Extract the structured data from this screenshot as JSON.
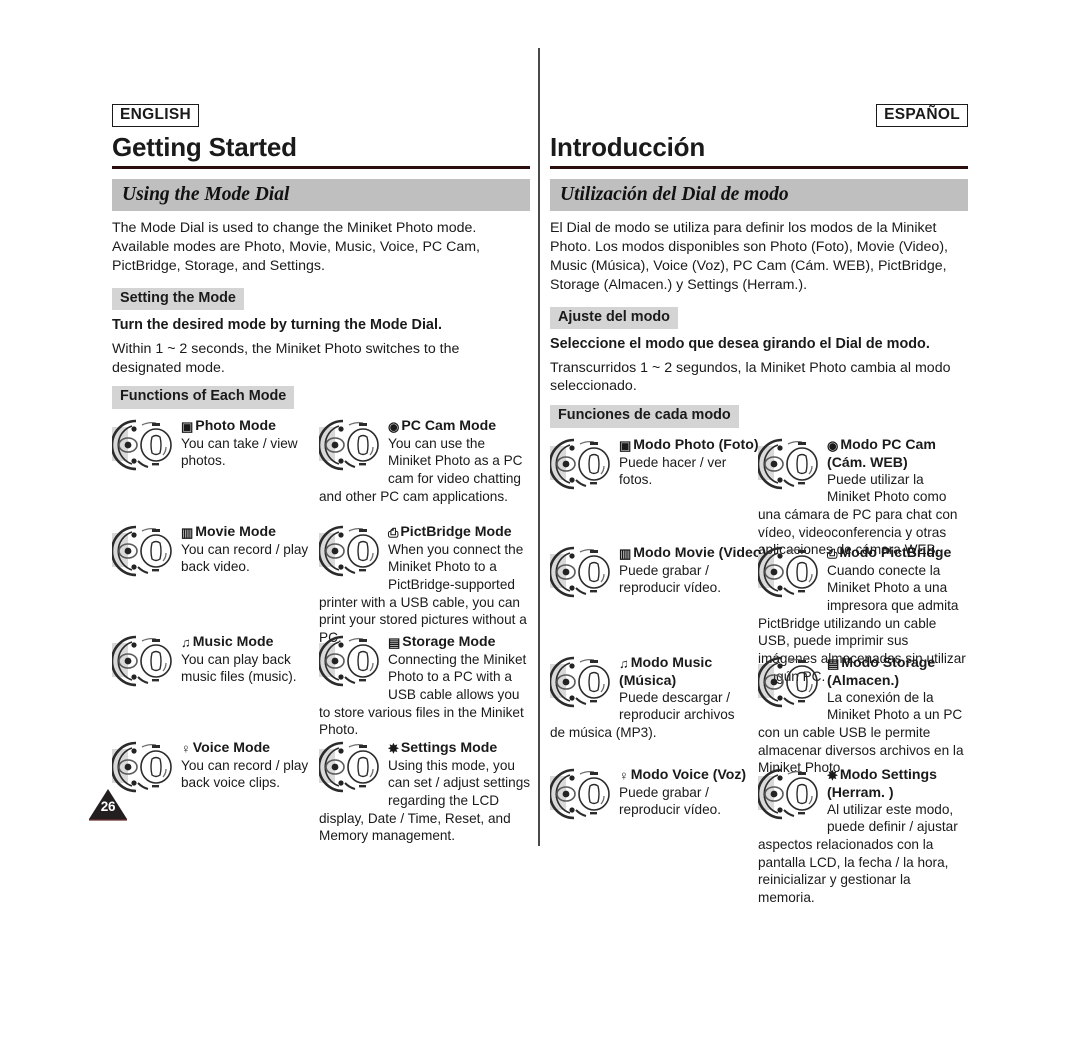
{
  "page": {
    "number": "26",
    "accent_rule_color": "#2b0d0d",
    "banner_bg": "#bfbfbf",
    "chip_bg": "#d4d4d4"
  },
  "english": {
    "lang_tag": "ENGLISH",
    "chapter_title": "Getting Started",
    "section_banner": "Using the Mode Dial",
    "intro": "The Mode Dial is used to change the Miniket Photo mode. Available modes are Photo, Movie, Music, Voice, PC Cam, PictBridge, Storage, and Settings.",
    "setting_chip": "Setting the Mode",
    "setting_bold": "Turn the desired mode by turning the Mode Dial.",
    "setting_text": "Within 1 ~ 2 seconds, the Miniket Photo switches to the designated mode.",
    "functions_chip": "Functions of Each Mode",
    "modes": [
      {
        "icon": "camera-icon",
        "heading": "Photo Mode",
        "heading2": "",
        "desc": "You can take / view photos."
      },
      {
        "icon": "webcam-icon",
        "heading": "PC Cam Mode",
        "heading2": "",
        "desc": "You can use the Miniket Photo as a PC cam for video chatting and other PC cam applications."
      },
      {
        "icon": "movie-camera-icon",
        "heading": "Movie Mode",
        "heading2": "",
        "desc": "You can record / play back video."
      },
      {
        "icon": "printer-icon",
        "heading": "PictBridge Mode",
        "heading2": "",
        "desc": "When you connect the Miniket Photo to a PictBridge-supported printer with a USB cable, you can print your stored pictures without a PC."
      },
      {
        "icon": "music-note-icon",
        "heading": "Music Mode",
        "heading2": "",
        "desc": "You can play back music files (music)."
      },
      {
        "icon": "storage-icon",
        "heading": "Storage Mode",
        "heading2": "",
        "desc": "Connecting the Miniket Photo to a PC with a USB cable allows you to store various files in the Miniket Photo."
      },
      {
        "icon": "microphone-icon",
        "heading": "Voice Mode",
        "heading2": "",
        "desc": "You can record / play back voice clips."
      },
      {
        "icon": "gear-icon",
        "heading": "Settings Mode",
        "heading2": "",
        "desc": "Using this mode, you can set / adjust settings regarding the LCD display, Date / Time, Reset, and Memory management."
      }
    ]
  },
  "spanish": {
    "lang_tag": "ESPAÑOL",
    "chapter_title": "Introducción",
    "section_banner": "Utilización del Dial de modo",
    "intro": "El Dial de modo se utiliza para definir los modos de la Miniket Photo. Los modos disponibles son Photo (Foto), Movie (Video), Music (Música), Voice (Voz), PC Cam (Cám. WEB), PictBridge, Storage (Almacen.) y Settings (Herram.).",
    "setting_chip": "Ajuste del modo",
    "setting_bold": "Seleccione el modo que desea girando el Dial de modo.",
    "setting_text": "Transcurridos 1 ~ 2 segundos, la Miniket Photo cambia al modo seleccionado.",
    "functions_chip": "Funciones de cada modo",
    "modes": [
      {
        "icon": "camera-icon",
        "heading": "Modo Photo (Foto)",
        "heading2": "",
        "desc": "Puede hacer / ver fotos."
      },
      {
        "icon": "webcam-icon",
        "heading": "Modo PC Cam",
        "heading2": "(Cám. WEB)",
        "desc": "Puede utilizar la Miniket Photo como una cámara de PC para chat con vídeo, videoconferencia y otras aplicaciones de cámara WEB."
      },
      {
        "icon": "movie-camera-icon",
        "heading": "Modo Movie (Video)",
        "heading2": "",
        "desc": "Puede grabar / reproducir vídeo."
      },
      {
        "icon": "printer-icon",
        "heading": "Modo PictBridge",
        "heading2": "",
        "desc": "Cuando conecte la Miniket Photo a una impresora que admita PictBridge utilizando un cable USB, puede imprimir sus imágenes almacenadas sin utilizar ningún PC."
      },
      {
        "icon": "music-note-icon",
        "heading": "Modo Music",
        "heading2": "(Música)",
        "desc": "Puede descargar / reproducir archivos de música (MP3)."
      },
      {
        "icon": "storage-icon",
        "heading": "Modo Storage",
        "heading2": "(Almacen.)",
        "desc": "La conexión de la Miniket Photo a un PC con un cable USB le permite almacenar diversos archivos en la Miniket Photo."
      },
      {
        "icon": "microphone-icon",
        "heading": "Modo Voice (Voz)",
        "heading2": "",
        "desc": "Puede grabar / reproducir vídeo."
      },
      {
        "icon": "gear-icon",
        "heading": "Modo Settings",
        "heading2": "(Herram. )",
        "desc": "Al utilizar este modo, puede definir / ajustar aspectos relacionados con la pantalla LCD, la fecha / la hora, reinicializar y gestionar la memoria."
      }
    ]
  }
}
